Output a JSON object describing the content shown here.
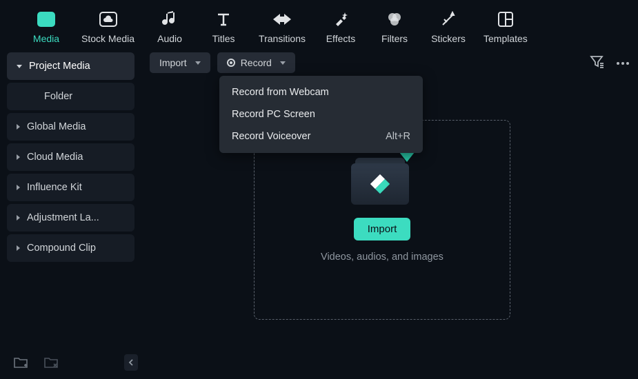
{
  "nav": [
    {
      "label": "Media",
      "active": true
    },
    {
      "label": "Stock Media"
    },
    {
      "label": "Audio"
    },
    {
      "label": "Titles"
    },
    {
      "label": "Transitions"
    },
    {
      "label": "Effects"
    },
    {
      "label": "Filters"
    },
    {
      "label": "Stickers"
    },
    {
      "label": "Templates"
    }
  ],
  "sidebar": {
    "header": "Project Media",
    "folder": "Folder",
    "items": [
      "Global Media",
      "Cloud Media",
      "Influence Kit",
      "Adjustment La...",
      "Compound Clip"
    ]
  },
  "toolbar": {
    "import_label": "Import",
    "record_label": "Record"
  },
  "record_menu": [
    {
      "label": "Record from Webcam",
      "shortcut": ""
    },
    {
      "label": "Record PC Screen",
      "shortcut": ""
    },
    {
      "label": "Record Voiceover",
      "shortcut": "Alt+R"
    }
  ],
  "dropzone": {
    "button": "Import",
    "hint": "Videos, audios, and images"
  },
  "colors": {
    "accent": "#3cdcc0"
  }
}
